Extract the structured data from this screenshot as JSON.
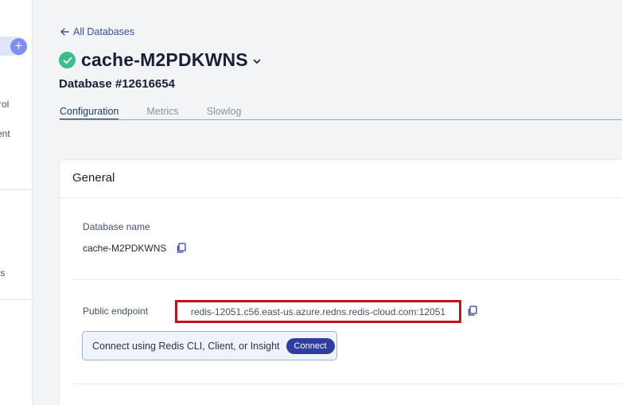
{
  "sidebar": {
    "items": [
      {
        "label": "rol"
      },
      {
        "label": "ent"
      },
      {
        "label": "ts"
      }
    ]
  },
  "header": {
    "back_link": "All Databases",
    "db_title": "cache-M2PDKWNS",
    "db_number": "Database #12616654",
    "status_color": "#3bbf8a"
  },
  "tabs": [
    {
      "label": "Configuration",
      "active": true
    },
    {
      "label": "Metrics",
      "active": false
    },
    {
      "label": "Slowlog",
      "active": false
    }
  ],
  "general": {
    "title": "General",
    "db_name_label": "Database name",
    "db_name_value": "cache-M2PDKWNS",
    "endpoint_label": "Public endpoint",
    "endpoint_value": "redis-12051.c56.east-us.azure.redns.redis-cloud.com:12051",
    "connect_text": "Connect using Redis CLI, Client, or Insight",
    "connect_button": "Connect"
  },
  "colors": {
    "accent": "#2f3e9e",
    "highlight_border": "#c0121c"
  }
}
